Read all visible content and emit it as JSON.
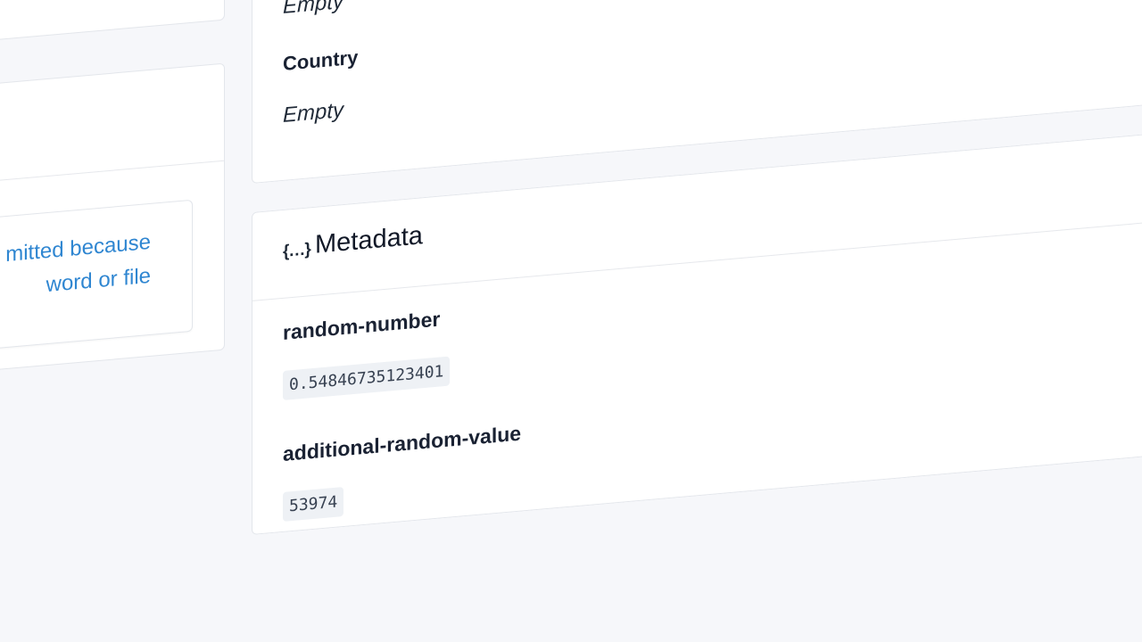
{
  "address_card": {
    "top_value": "Empty",
    "country_label": "Country",
    "country_value": "Empty"
  },
  "left_panel": {
    "notice_lines": [
      "mitted because",
      "word or file"
    ],
    "notice_color": "#2f86d1"
  },
  "metadata_card": {
    "icon": "{…}",
    "title": "Metadata",
    "entries": [
      {
        "key": "random-number",
        "value": "0.54846735123401"
      },
      {
        "key": "additional-random-value",
        "value": "53974"
      }
    ]
  }
}
